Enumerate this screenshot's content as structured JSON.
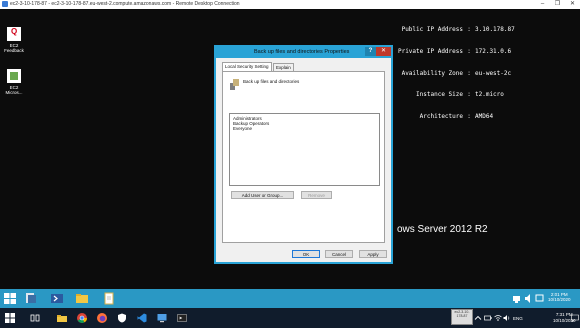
{
  "rdp": {
    "title": "ec2-3-10-178-87 - ec2-3-10-178-87.eu-west-2.compute.amazonaws.com - Remote Desktop Connection",
    "minimize": "–",
    "maximize": "❐",
    "close": "✕"
  },
  "desktop": {
    "icons": [
      {
        "label_line1": "EC2",
        "label_line2": "Feedback",
        "icon": "feedback-icon"
      },
      {
        "label_line1": "EC2",
        "label_line2": "Micros...",
        "icon": "document-icon"
      }
    ],
    "sysinfo": [
      {
        "key": "Public IP Address",
        "value": "3.10.178.87"
      },
      {
        "key": "Private IP Address",
        "value": "172.31.0.6"
      },
      {
        "key": "Availability Zone",
        "value": "eu-west-2c"
      },
      {
        "key": "Instance Size",
        "value": "t2.micro"
      },
      {
        "key": "Architecture",
        "value": "AMD64"
      }
    ],
    "brand_text": "ows Server 2012 R2"
  },
  "dialog": {
    "title": "Back up files and directories Properties",
    "help": "?",
    "close": "✕",
    "tabs": [
      "Local Security Setting",
      "Explain"
    ],
    "policy_name": "Back up files and directories",
    "members": [
      "Administrators",
      "Backup Operators",
      "Everyone"
    ],
    "add_button": "Add User or Group...",
    "remove_button": "Remove",
    "ok": "OK",
    "cancel": "Cancel",
    "apply": "Apply"
  },
  "remote_taskbar": {
    "time": "2:01 PM",
    "date": "10/10/2020"
  },
  "local_taskbar": {
    "thumbnail_text": "ec2-3-10-178-87",
    "lang": "ENG",
    "time": "7:31 PM",
    "date": "10/10/2020"
  },
  "colors": {
    "accent": "#29a3d6",
    "remote_taskbar": "#2a98c4",
    "local_taskbar": "#101c2c"
  }
}
